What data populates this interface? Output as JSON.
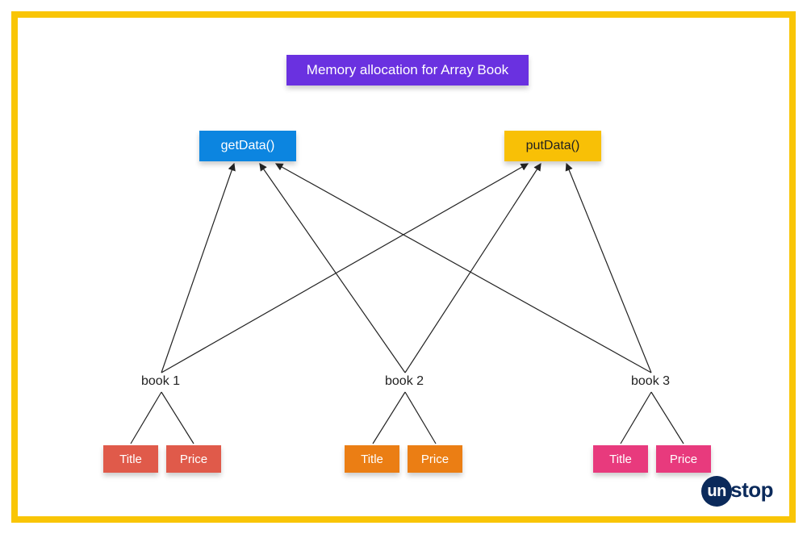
{
  "title": "Memory allocation for Array Book",
  "methods": {
    "get": "getData()",
    "put": "putData()"
  },
  "books": [
    {
      "label": "book 1",
      "title": "Title",
      "price": "Price"
    },
    {
      "label": "book 2",
      "title": "Title",
      "price": "Price"
    },
    {
      "label": "book 3",
      "title": "Title",
      "price": "Price"
    }
  ],
  "logo": {
    "prefix": "un",
    "suffix": "stop"
  }
}
